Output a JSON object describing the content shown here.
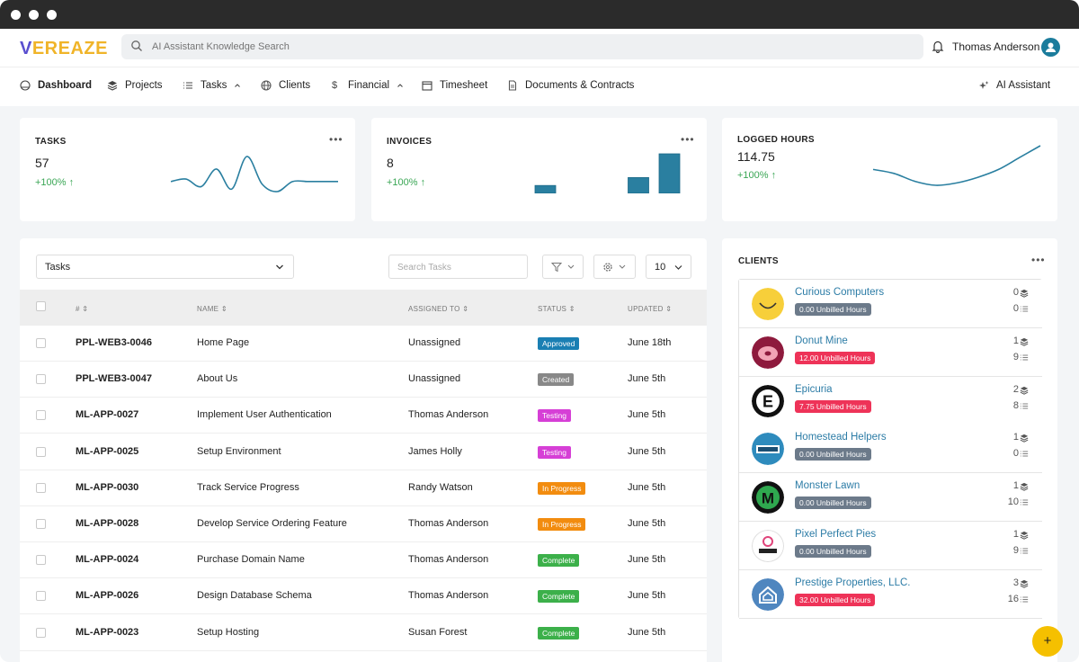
{
  "logo": {
    "v": "V",
    "rest": "EREAZE"
  },
  "search": {
    "placeholder": "AI Assistant Knowledge Search"
  },
  "user": {
    "name": "Thomas Anderson"
  },
  "nav": {
    "dashboard": "Dashboard",
    "projects": "Projects",
    "tasks": "Tasks",
    "clients": "Clients",
    "financial": "Financial",
    "timesheet": "Timesheet",
    "documents": "Documents & Contracts",
    "ai_assistant": "AI Assistant"
  },
  "stats": {
    "tasks": {
      "label": "TASKS",
      "value": "57",
      "change": "+100% ↑"
    },
    "invoices": {
      "label": "INVOICES",
      "value": "8",
      "change": "+100% ↑"
    },
    "hours": {
      "label": "LOGGED HOURS",
      "value": "114.75",
      "change": "+100% ↑"
    }
  },
  "chart_data": [
    {
      "type": "line",
      "title": "",
      "series": [
        {
          "values": [
            0,
            1,
            -2,
            5,
            -3,
            10,
            -1,
            -4,
            0,
            0,
            0,
            0
          ]
        }
      ]
    },
    {
      "type": "bar",
      "title": "",
      "series": [
        {
          "values": [
            1,
            0,
            0,
            2,
            5
          ]
        }
      ]
    },
    {
      "type": "line",
      "title": "",
      "series": [
        {
          "values": [
            3,
            2.5,
            1.5,
            1,
            1.3,
            2,
            3,
            4.5,
            6
          ]
        }
      ]
    }
  ],
  "table": {
    "select_value": "Tasks",
    "search_placeholder": "Search Tasks",
    "page_size": "10",
    "headers": {
      "num": "#",
      "name": "NAME",
      "assigned": "ASSIGNED TO",
      "status": "STATUS",
      "updated": "UPDATED"
    },
    "rows": [
      {
        "id": "PPL-WEB3-0046",
        "name": "Home Page",
        "assigned": "Unassigned",
        "status": "Approved",
        "updated": "June 18th"
      },
      {
        "id": "PPL-WEB3-0047",
        "name": "About Us",
        "assigned": "Unassigned",
        "status": "Created",
        "updated": "June 5th"
      },
      {
        "id": "ML-APP-0027",
        "name": "Implement User Authentication",
        "assigned": "Thomas Anderson",
        "status": "Testing",
        "updated": "June 5th"
      },
      {
        "id": "ML-APP-0025",
        "name": "Setup Environment",
        "assigned": "James Holly",
        "status": "Testing",
        "updated": "June 5th"
      },
      {
        "id": "ML-APP-0030",
        "name": "Track Service Progress",
        "assigned": "Randy Watson",
        "status": "In Progress",
        "updated": "June 5th"
      },
      {
        "id": "ML-APP-0028",
        "name": "Develop Service Ordering Feature",
        "assigned": "Thomas Anderson",
        "status": "In Progress",
        "updated": "June 5th"
      },
      {
        "id": "ML-APP-0024",
        "name": "Purchase Domain Name",
        "assigned": "Thomas Anderson",
        "status": "Complete",
        "updated": "June 5th"
      },
      {
        "id": "ML-APP-0026",
        "name": "Design Database Schema",
        "assigned": "Thomas Anderson",
        "status": "Complete",
        "updated": "June 5th"
      },
      {
        "id": "ML-APP-0023",
        "name": "Setup Hosting",
        "assigned": "Susan Forest",
        "status": "Complete",
        "updated": "June 5th"
      }
    ]
  },
  "status_colors": {
    "Approved": "#1a7fb3",
    "Created": "#888888",
    "Testing": "#d63fd6",
    "In Progress": "#f28c0f",
    "Complete": "#3cb04a"
  },
  "clients": {
    "title": "CLIENTS",
    "items": [
      {
        "name": "Curious Computers",
        "hours": "0.00 Unbilled Hours",
        "projects": "0",
        "tasks": "0",
        "hours_color": "#6c7a8a",
        "logo": "smiley-logo-icon"
      },
      {
        "name": "Donut Mine",
        "hours": "12.00 Unbilled Hours",
        "projects": "1",
        "tasks": "9",
        "hours_color": "#ee3358",
        "logo": "donut-logo-icon"
      },
      {
        "name": "Epicuria",
        "hours": "7.75 Unbilled Hours",
        "projects": "2",
        "tasks": "8",
        "hours_color": "#ee3358",
        "logo": "letter-e-logo-icon"
      },
      {
        "name": "Homestead Helpers",
        "hours": "0.00 Unbilled Hours",
        "projects": "1",
        "tasks": "0",
        "hours_color": "#6c7a8a",
        "logo": "homestead-logo-icon"
      },
      {
        "name": "Monster Lawn",
        "hours": "0.00 Unbilled Hours",
        "projects": "1",
        "tasks": "10",
        "hours_color": "#6c7a8a",
        "logo": "letter-m-logo-icon"
      },
      {
        "name": "Pixel Perfect Pies",
        "hours": "0.00 Unbilled Hours",
        "projects": "1",
        "tasks": "9",
        "hours_color": "#6c7a8a",
        "logo": "pixel-logo-icon"
      },
      {
        "name": "Prestige Properties, LLC.",
        "hours": "32.00 Unbilled Hours",
        "projects": "3",
        "tasks": "16",
        "hours_color": "#ee3358",
        "logo": "house-logo-icon"
      }
    ]
  },
  "colors": {
    "accent": "#2c7ca6",
    "chart": "#2a7fa0",
    "fab": "#f5c000"
  },
  "fab": {
    "label": "+"
  }
}
